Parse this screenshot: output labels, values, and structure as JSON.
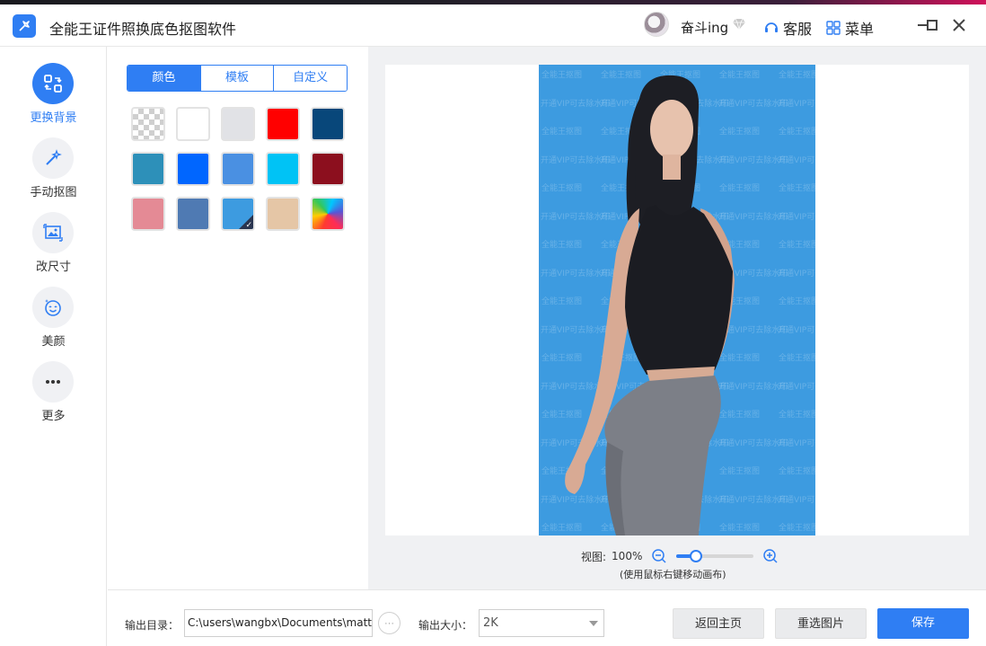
{
  "app": {
    "title": "全能王证件照换底色抠图软件"
  },
  "user": {
    "name": "奋斗ing"
  },
  "header": {
    "service_label": "客服",
    "menu_label": "菜单"
  },
  "sidebar": {
    "items": [
      {
        "label": "更换背景",
        "icon": "swap-background-icon",
        "active": true
      },
      {
        "label": "手动抠图",
        "icon": "magic-wand-icon",
        "active": false
      },
      {
        "label": "改尺寸",
        "icon": "resize-image-icon",
        "active": false
      },
      {
        "label": "美颜",
        "icon": "beauty-face-icon",
        "active": false
      },
      {
        "label": "更多",
        "icon": "more-dots-icon",
        "active": false
      }
    ]
  },
  "panel": {
    "tabs": [
      {
        "label": "颜色",
        "active": true
      },
      {
        "label": "模板",
        "active": false
      },
      {
        "label": "自定义",
        "active": false
      }
    ],
    "swatches": [
      {
        "color": "transparent",
        "type": "transparent"
      },
      {
        "color": "#ffffff"
      },
      {
        "color": "#e1e2e6"
      },
      {
        "color": "#ff0000"
      },
      {
        "color": "#08477a"
      },
      {
        "color": "#2d90b9"
      },
      {
        "color": "#0066ff"
      },
      {
        "color": "#4a90e2"
      },
      {
        "color": "#00c3f5"
      },
      {
        "color": "#8c0f1e"
      },
      {
        "color": "#e48a95"
      },
      {
        "color": "#4f7ab3"
      },
      {
        "color": "#3d9be0",
        "selected": true
      },
      {
        "color": "#e5c6a6"
      },
      {
        "color": "gradient",
        "type": "gradient"
      }
    ]
  },
  "preview": {
    "background_color": "#3d9be0",
    "watermark_lines": [
      "全能王抠图",
      "开通VIP可去除水印"
    ]
  },
  "zoom": {
    "label": "视图:",
    "value": "100%",
    "level": 0.25,
    "hint": "(使用鼠标右键移动画布)"
  },
  "bottom": {
    "output_dir_label": "输出目录：",
    "output_dir_value": "C:\\users\\wangbx\\Documents\\matting",
    "browse_label": "···",
    "output_size_label": "输出大小：",
    "output_size_value": "2K",
    "back_home_label": "返回主页",
    "reselect_label": "重选图片",
    "save_label": "保存"
  },
  "theme": {
    "accent": "#2f7ef3"
  }
}
